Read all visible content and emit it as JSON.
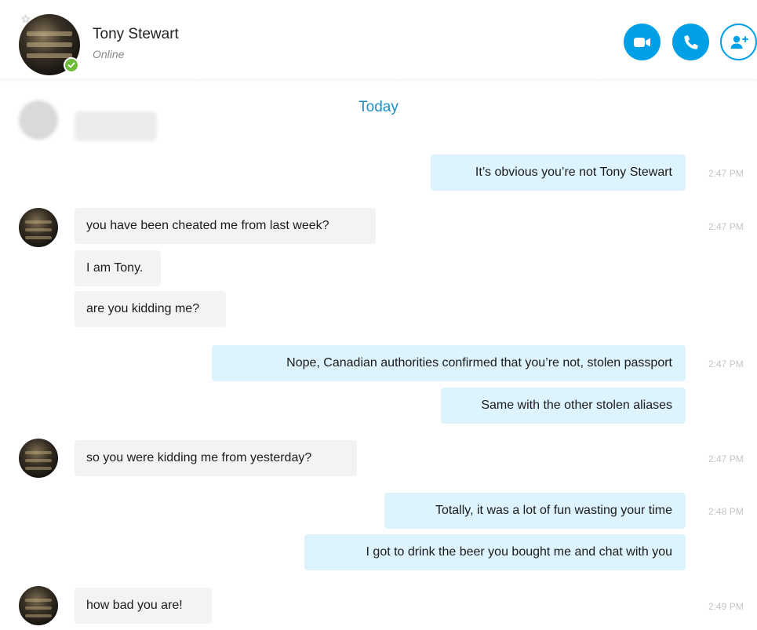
{
  "header": {
    "name": "Tony Stewart",
    "status": "Online",
    "buttons": {
      "video": "video-camera-icon",
      "call": "phone-icon",
      "add": "add-person-icon"
    }
  },
  "date_separator": "Today",
  "colors": {
    "accent": "#00a0e6",
    "outgoing_bubble": "#ddf3fd",
    "incoming_bubble": "#f3f3f3",
    "presence": "#6cbc3a",
    "date_text": "#1b8fc5"
  },
  "messages": [
    {
      "direction": "out",
      "text": "It’s obvious you’re not Tony Stewart",
      "time": "2:47 PM"
    },
    {
      "direction": "in",
      "text": "you have been cheated me from last week?",
      "time": "2:47 PM"
    },
    {
      "direction": "in",
      "text": "I am Tony.",
      "time": ""
    },
    {
      "direction": "in",
      "text": "are you kidding me?",
      "time": ""
    },
    {
      "direction": "out",
      "text": "Nope, Canadian authorities confirmed that you’re not, stolen passport",
      "time": "2:47 PM"
    },
    {
      "direction": "out",
      "text": "Same with the other stolen aliases",
      "time": ""
    },
    {
      "direction": "in",
      "text": "so you were kidding me from yesterday?",
      "time": "2:47 PM"
    },
    {
      "direction": "out",
      "text": "Totally, it was a lot of fun wasting your time",
      "time": "2:48 PM"
    },
    {
      "direction": "out",
      "text": "I got to drink the beer you bought me and chat with you",
      "time": ""
    },
    {
      "direction": "in",
      "text": "how bad you are!",
      "time": "2:49 PM"
    }
  ]
}
